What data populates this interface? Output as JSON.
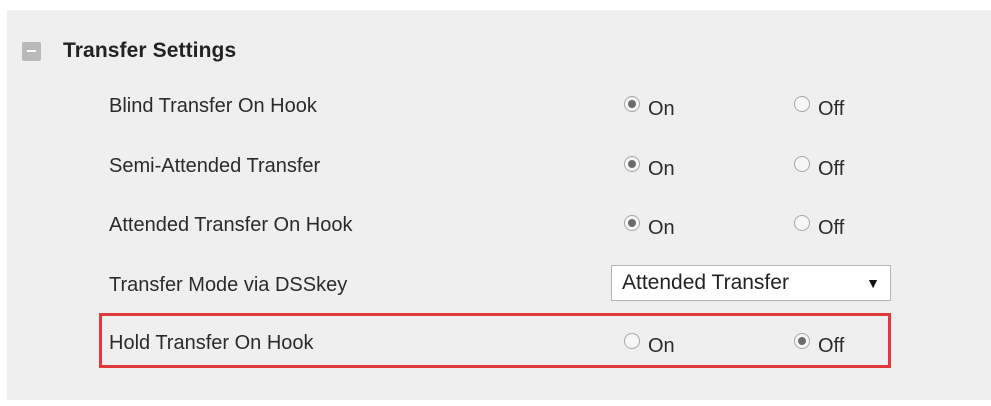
{
  "section": {
    "title": "Transfer Settings",
    "collapse_icon": "minus-icon"
  },
  "rows": [
    {
      "label": "Blind Transfer On Hook",
      "on_label": "On",
      "off_label": "Off",
      "selected": "On"
    },
    {
      "label": "Semi-Attended Transfer",
      "on_label": "On",
      "off_label": "Off",
      "selected": "On"
    },
    {
      "label": "Attended Transfer On Hook",
      "on_label": "On",
      "off_label": "Off",
      "selected": "On"
    },
    {
      "label": "Transfer Mode via DSSkey",
      "select_value": "Attended Transfer",
      "select_arrow": "▼"
    },
    {
      "label": "Hold Transfer On Hook",
      "on_label": "On",
      "off_label": "Off",
      "selected": "Off"
    }
  ],
  "colors": {
    "highlight": "#e03a3a",
    "panel_bg": "#efefef"
  }
}
